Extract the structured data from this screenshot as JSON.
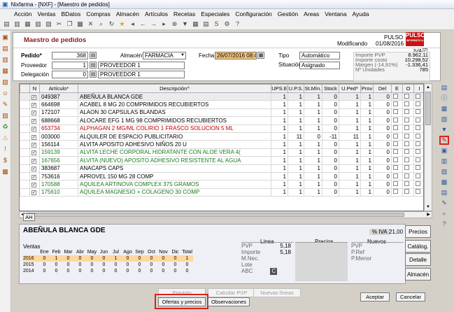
{
  "window": {
    "title": "Nixfarma - [NXF] - [Maestro de pedidos]"
  },
  "menu": [
    "Acción",
    "Ventas",
    "BDatos",
    "Compras",
    "Almacén",
    "Artículos",
    "Recetas",
    "Especiales",
    "Configuración",
    "Gestión",
    "Areas",
    "Ventana",
    "Ayuda"
  ],
  "form": {
    "title": "Maestro de pedidos",
    "user": "PULSO",
    "modified_label": "Modificando",
    "modified_date": "01/08/2016",
    "logo": "PULSO",
    "logo_sub": "INFORMÁTICA",
    "pedido_label": "Pedido*",
    "pedido_value": "368",
    "almacen_label": "Almacén*",
    "almacen_value": "FARMACIA",
    "fecha_label": "Fecha",
    "fecha_value": "26/07/2016 08:48",
    "tipo_label": "Tipo",
    "tipo_value": "Automático",
    "situacion_label": "Situación",
    "situacion_value": "Asignado",
    "proveedor_label": "Proveedor",
    "proveedor_code": "1",
    "proveedor_name": "PROVEEDOR 1",
    "delegacion_label": "Delegación",
    "delegacion_code": "0",
    "delegacion_name": "PROVEEDOR 1",
    "iva_label": "IVA"
  },
  "stats": [
    {
      "label": "Importe PVP",
      "value": "8.962,11"
    },
    {
      "label": "Importe costo",
      "value": "10.298,52"
    },
    {
      "label": "Margen (-14,91%)",
      "value": "-1.336,41"
    },
    {
      "label": "Nº Unidades",
      "value": "785"
    }
  ],
  "grid": {
    "headers": [
      "N",
      "Artículo*",
      "Descripción^",
      "UPS.E",
      "U.P.S.",
      "St.Mín.",
      "Stock",
      "U.Ped*",
      "Prov",
      "Del",
      "E",
      "O",
      "I"
    ],
    "rows": [
      {
        "code": "049387",
        "desc": "ABEÑULA BLANCA GDE",
        "ups_e": "1",
        "ups": "1",
        "stmin": "1",
        "stock": "0",
        "uped": "1",
        "prov": "1",
        "del": "0",
        "color": "#000000",
        "selected": true
      },
      {
        "code": "664698",
        "desc": "ACABEL 8 MG 20 COMPRIMIDOS RECUBIERTOS",
        "ups_e": "1",
        "ups": "1",
        "stmin": "1",
        "stock": "0",
        "uped": "1",
        "prov": "1",
        "del": "0",
        "color": "#000000"
      },
      {
        "code": "172107",
        "desc": "ALAON  30 CAPSULAS BLANDAS",
        "ups_e": "1",
        "ups": "1",
        "stmin": "1",
        "stock": "0",
        "uped": "1",
        "prov": "1",
        "del": "0",
        "color": "#000000"
      },
      {
        "code": "688668",
        "desc": "ALOCARE EFG 1 MG 98 COMPRIMIDOS RECUBIERTOS",
        "ups_e": "1",
        "ups": "1",
        "stmin": "1",
        "stock": "0",
        "uped": "1",
        "prov": "1",
        "del": "0",
        "color": "#000000"
      },
      {
        "code": "653734",
        "desc": "ALPHAGAN 2 MG/ML COLIRIO 1 FRASCO SOLUCION 5 ML",
        "ups_e": "1",
        "ups": "1",
        "stmin": "1",
        "stock": "0",
        "uped": "1",
        "prov": "1",
        "del": "0",
        "color": "#c00000"
      },
      {
        "code": "003000",
        "desc": "ALQUILER DE ESPACIO PUBLICITARIO",
        "ups_e": "1",
        "ups": "11",
        "stmin": "0",
        "stock": "-11",
        "uped": "11",
        "prov": "1",
        "del": "0",
        "color": "#000000"
      },
      {
        "code": "156114",
        "desc": "ALVITA APOSITO ADHESIVO NIÑOS 20 U",
        "ups_e": "1",
        "ups": "1",
        "stmin": "1",
        "stock": "0",
        "uped": "1",
        "prov": "1",
        "del": "0",
        "color": "#000000"
      },
      {
        "code": "159139",
        "desc": "ALVITA LECHE CORPORAL HIDRATANTE CON ALOE VERA  4(",
        "ups_e": "1",
        "ups": "1",
        "stmin": "1",
        "stock": "0",
        "uped": "1",
        "prov": "1",
        "del": "0",
        "color": "#1a7a1a"
      },
      {
        "code": "167656",
        "desc": "ALVITA (NUEVO) APOSITO ADHESIVO RESISTENTE AL AGUA",
        "ups_e": "1",
        "ups": "1",
        "stmin": "1",
        "stock": "0",
        "uped": "1",
        "prov": "1",
        "del": "0",
        "color": "#1a7a1a"
      },
      {
        "code": "383687",
        "desc": "ANACAPS  CAPS",
        "ups_e": "1",
        "ups": "1",
        "stmin": "1",
        "stock": "0",
        "uped": "1",
        "prov": "1",
        "del": "0",
        "color": "#000000"
      },
      {
        "code": "753616",
        "desc": "APROVEL 150 MG 28 COMP",
        "ups_e": "1",
        "ups": "1",
        "stmin": "1",
        "stock": "0",
        "uped": "1",
        "prov": "1",
        "del": "0",
        "color": "#000000"
      },
      {
        "code": "170588",
        "desc": "AQUILEA ARTINOVA COMPLEX  375 GRAMOS",
        "ups_e": "1",
        "ups": "1",
        "stmin": "1",
        "stock": "0",
        "uped": "1",
        "prov": "1",
        "del": "0",
        "color": "#1a7a1a"
      },
      {
        "code": "175610",
        "desc": "AQUILEA MAGNESIO + COLAGENO  30 COMP",
        "ups_e": "1",
        "ups": "1",
        "stmin": "1",
        "stock": "0",
        "uped": "1",
        "prov": "1",
        "del": "0",
        "color": "#1a7a1a"
      }
    ]
  },
  "ah_label": "AH",
  "detail": {
    "name": "ABEÑULA BLANCA GDE",
    "iva_label": "% IVA",
    "iva_value": "21,00",
    "ventas_label": "Ventas",
    "months": [
      "Ene",
      "Feb",
      "Mar",
      "Abr",
      "May",
      "Jun",
      "Jul",
      "Ago",
      "Sep",
      "Oct",
      "Nov",
      "Dic",
      "Total"
    ],
    "sales": [
      {
        "year": "2016",
        "values": [
          "0",
          "1",
          "0",
          "0",
          "0",
          "0",
          "1",
          "0",
          "0",
          "0",
          "0",
          "0",
          "1"
        ]
      },
      {
        "year": "2015",
        "values": [
          "0",
          "0",
          "0",
          "0",
          "0",
          "0",
          "0",
          "0",
          "0",
          "0",
          "0",
          "0",
          "0"
        ]
      },
      {
        "year": "2014",
        "values": [
          "0",
          "0",
          "0",
          "0",
          "0",
          "0",
          "0",
          "0",
          "0",
          "0",
          "0",
          "0",
          "0"
        ]
      }
    ],
    "linea_label": "Linea",
    "precios_label": "Precios",
    "nuevos_label": "Nuevos",
    "pvp_label": "PVP",
    "pvp_value": "5,18",
    "importe_label": "Importe",
    "importe_value": "5,18",
    "mnec_label": "M.Nec.",
    "lote_label": "Lote",
    "abc_label": "ABC",
    "abc_value": "C",
    "n_pvp_label": "PVP",
    "n_pref_label": "P.Ref",
    "n_pmenor_label": "P.Menor"
  },
  "side_buttons": [
    "Precios",
    "Catálog.",
    "Detalle",
    "Almacén"
  ],
  "bottom": {
    "previsto": "Previsto",
    "calcular": "Calcular PVP",
    "nuevas": "Nuevas líneas",
    "ofertas": "Ofertas y precios",
    "observaciones": "Observaciones",
    "aceptar": "Aceptar",
    "cancelar": "Cancelar"
  },
  "colors": {
    "accent": "#8a1a1a",
    "highlight": "#e02020",
    "date_bg": "#f5c67a",
    "selected_row": "#ececec"
  },
  "icons": {
    "toolbar": [
      "new-icon",
      "open-icon",
      "save-icon",
      "print-icon",
      "preview-icon",
      "cut-icon",
      "copy-icon",
      "paste-icon",
      "delete-icon",
      "search-icon",
      "refresh-icon",
      "star-icon",
      "first-icon",
      "prev-icon",
      "next-icon",
      "last-icon",
      "zoom-icon",
      "filter-icon",
      "calendar-icon",
      "report-icon",
      "export-icon",
      "settings-icon",
      "help-icon"
    ],
    "left": [
      "sales-icon",
      "orders-icon",
      "receipts-icon",
      "stock-icon",
      "invoice-icon",
      "user-icon",
      "edit-icon",
      "chart-icon",
      "recycle-icon",
      "warning-icon",
      "alert-icon",
      "cash-icon",
      "grid-icon"
    ],
    "right": [
      "list-icon",
      "info-icon",
      "calc-icon",
      "print-icon",
      "filter-icon",
      "tag-icon",
      "truck-icon",
      "box-icon",
      "doc-icon",
      "note-icon",
      "chart-icon",
      "edit-icon",
      "search-icon",
      "help-icon"
    ]
  }
}
